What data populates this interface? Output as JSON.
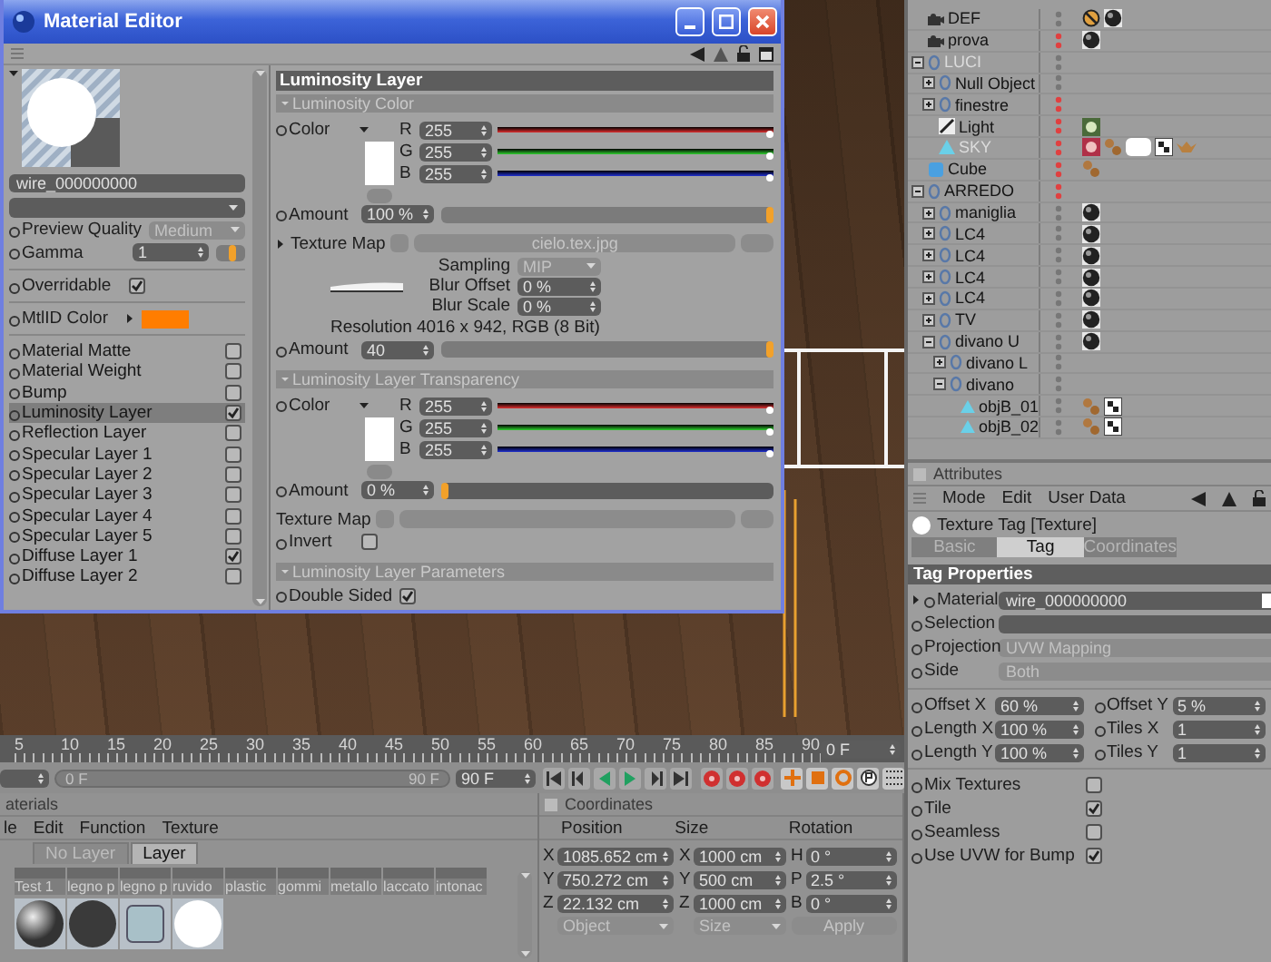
{
  "material_editor": {
    "title": "Material Editor",
    "preview": {
      "name": "wire_000000000"
    },
    "preview_quality": {
      "label": "Preview Quality",
      "value": "Medium"
    },
    "gamma": {
      "label": "Gamma",
      "value": "1",
      "level": 0.55
    },
    "overridable": {
      "label": "Overridable",
      "checked": true
    },
    "mtlid_color": {
      "label": "MtlID Color"
    },
    "channels": [
      {
        "label": "Material Matte",
        "checked": false,
        "selected": false
      },
      {
        "label": "Material Weight",
        "checked": false,
        "selected": false
      },
      {
        "label": "Bump",
        "checked": false,
        "selected": false
      },
      {
        "label": "Luminosity Layer",
        "checked": true,
        "selected": true
      },
      {
        "label": "Reflection Layer",
        "checked": false,
        "selected": false
      },
      {
        "label": "Specular Layer 1",
        "checked": false,
        "selected": false
      },
      {
        "label": "Specular Layer 2",
        "checked": false,
        "selected": false
      },
      {
        "label": "Specular Layer 3",
        "checked": false,
        "selected": false
      },
      {
        "label": "Specular Layer 4",
        "checked": false,
        "selected": false
      },
      {
        "label": "Specular Layer 5",
        "checked": false,
        "selected": false
      },
      {
        "label": "Diffuse Layer 1",
        "checked": true,
        "selected": false
      },
      {
        "label": "Diffuse Layer 2",
        "checked": false,
        "selected": false
      }
    ],
    "layer": {
      "title": "Luminosity Layer",
      "color_section": {
        "title": "Luminosity Color",
        "color": {
          "label": "Color",
          "channels": [
            {
              "name": "R",
              "value": "255",
              "level": 1
            },
            {
              "name": "G",
              "value": "255",
              "level": 1
            },
            {
              "name": "B",
              "value": "255",
              "level": 1
            }
          ]
        },
        "amount": {
          "label": "Amount",
          "value": "100 %",
          "level": 1
        },
        "texture": {
          "label": "Texture Map",
          "file": "cielo.tex.jpg",
          "sampling": {
            "label": "Sampling",
            "value": "MIP"
          },
          "blur_offset": {
            "label": "Blur Offset",
            "value": "0 %"
          },
          "blur_scale": {
            "label": "Blur Scale",
            "value": "0 %"
          },
          "resolution": "Resolution 4016 x 942, RGB (8 Bit)"
        },
        "amount_2": {
          "label": "Amount",
          "value": "40",
          "level": 1
        }
      },
      "transparency_section": {
        "title": "Luminosity Layer Transparency",
        "color": {
          "label": "Color",
          "channels": [
            {
              "name": "R",
              "value": "255",
              "level": 1
            },
            {
              "name": "G",
              "value": "255",
              "level": 1
            },
            {
              "name": "B",
              "value": "255",
              "level": 1
            }
          ]
        },
        "amount": {
          "label": "Amount",
          "value": "0 %",
          "level": 0
        },
        "texture": {
          "label": "Texture Map"
        },
        "invert": {
          "label": "Invert",
          "checked": false
        }
      },
      "parameters_section": {
        "title": "Luminosity Layer Parameters",
        "double_sided": {
          "label": "Double Sided",
          "checked": true
        }
      }
    }
  },
  "timeline": {
    "ruler_labels": [
      "5",
      "10",
      "15",
      "20",
      "25",
      "30",
      "35",
      "40",
      "45",
      "50",
      "55",
      "60",
      "65",
      "70",
      "75",
      "80",
      "85",
      "90"
    ],
    "current_frame": "0 F",
    "range_start": "0 F",
    "range_end": "90 F",
    "end_frame": "90 F"
  },
  "materials": {
    "title": "aterials",
    "menu": [
      "le",
      "Edit",
      "Function",
      "Texture"
    ],
    "tabs": [
      {
        "label": "No Layer",
        "selected": false
      },
      {
        "label": "Layer",
        "selected": true
      }
    ],
    "items": [
      {
        "name": "Test 1"
      },
      {
        "name": "legno p"
      },
      {
        "name": "legno p"
      },
      {
        "name": "ruvido"
      },
      {
        "name": "plastic"
      },
      {
        "name": "gommi"
      },
      {
        "name": "metallo"
      },
      {
        "name": "laccato"
      },
      {
        "name": "intonac"
      }
    ],
    "swatches": [
      {
        "kind": "gradient"
      },
      {
        "kind": "dark"
      },
      {
        "kind": "glass"
      },
      {
        "kind": "white"
      }
    ]
  },
  "coordinates": {
    "title": "Coordinates",
    "columns": [
      "Position",
      "Size",
      "Rotation"
    ],
    "rows": [
      {
        "axes": [
          "X",
          "X",
          "H"
        ],
        "values": [
          "1085.652 cm",
          "1000 cm",
          "0 °"
        ]
      },
      {
        "axes": [
          "Y",
          "Y",
          "P"
        ],
        "values": [
          "750.272 cm",
          "500 cm",
          "2.5 °"
        ]
      },
      {
        "axes": [
          "Z",
          "Z",
          "B"
        ],
        "values": [
          "22.132 cm",
          "1000 cm",
          "0 °"
        ]
      }
    ],
    "modes": [
      "Object",
      "Size"
    ],
    "apply": "Apply"
  },
  "object_manager": {
    "items": [
      {
        "name": "DEF",
        "kind": "camera",
        "visible": true,
        "dimmed": false,
        "tags": [
          {
            "kind": "forbid"
          },
          {
            "kind": "sphere"
          }
        ]
      },
      {
        "name": "prova",
        "kind": "camera",
        "visible": false,
        "dimmed": false,
        "tags": [
          {
            "kind": "sphere"
          }
        ]
      },
      {
        "name": "LUCI",
        "kind": "null",
        "expanded": true,
        "visible": true,
        "dimmed": true,
        "children": [
          {
            "name": "Null Object",
            "kind": "null",
            "expanded": false,
            "visible": true,
            "dimmed": false
          },
          {
            "name": "finestre",
            "kind": "null",
            "expanded": false,
            "visible": false,
            "dimmed": false
          },
          {
            "name": "Light",
            "kind": "light",
            "visible": false,
            "dimmed": false,
            "tags": [
              {
                "kind": "target"
              }
            ]
          },
          {
            "name": "SKY",
            "kind": "triangle",
            "visible": false,
            "dimmed": true,
            "tags": [
              {
                "kind": "badge"
              },
              {
                "kind": "beads"
              },
              {
                "kind": "swatch"
              },
              {
                "kind": "checker"
              },
              {
                "kind": "crown"
              }
            ]
          }
        ]
      },
      {
        "name": "Cube",
        "kind": "cube",
        "visible": false,
        "dimmed": false,
        "tags": [
          {
            "kind": "beads"
          }
        ]
      },
      {
        "name": "ARREDO",
        "kind": "null",
        "expanded": true,
        "visible": false,
        "dimmed": false,
        "children": [
          {
            "name": "maniglia",
            "kind": "null",
            "expanded": false,
            "visible": true,
            "dimmed": false,
            "tags": [
              {
                "kind": "sphere"
              }
            ]
          },
          {
            "name": "LC4",
            "kind": "null",
            "expanded": false,
            "visible": true,
            "dimmed": false,
            "tags": [
              {
                "kind": "sphere"
              }
            ]
          },
          {
            "name": "LC4",
            "kind": "null",
            "expanded": false,
            "visible": true,
            "dimmed": false,
            "tags": [
              {
                "kind": "sphere"
              }
            ]
          },
          {
            "name": "LC4",
            "kind": "null",
            "expanded": false,
            "visible": true,
            "dimmed": false,
            "tags": [
              {
                "kind": "sphere"
              }
            ]
          },
          {
            "name": "LC4",
            "kind": "null",
            "expanded": false,
            "visible": true,
            "dimmed": false,
            "tags": [
              {
                "kind": "sphere"
              }
            ]
          },
          {
            "name": "TV",
            "kind": "null",
            "expanded": false,
            "visible": true,
            "dimmed": false,
            "tags": [
              {
                "kind": "sphere"
              }
            ]
          },
          {
            "name": "divano U",
            "kind": "null",
            "expanded": true,
            "visible": true,
            "dimmed": false,
            "tags": [
              {
                "kind": "sphere"
              }
            ],
            "children": [
              {
                "name": "divano L",
                "kind": "null",
                "expanded": false,
                "visible": true,
                "dimmed": false
              },
              {
                "name": "divano",
                "kind": "null",
                "expanded": true,
                "visible": true,
                "dimmed": false,
                "children": [
                  {
                    "name": "objB_01",
                    "kind": "triangle",
                    "visible": true,
                    "dimmed": false,
                    "tags": [
                      {
                        "kind": "beads"
                      },
                      {
                        "kind": "checker"
                      }
                    ]
                  },
                  {
                    "name": "objB_02",
                    "kind": "triangle",
                    "visible": true,
                    "dimmed": false,
                    "tags": [
                      {
                        "kind": "beads"
                      },
                      {
                        "kind": "checker"
                      }
                    ]
                  }
                ]
              }
            ]
          }
        ]
      }
    ]
  },
  "attributes": {
    "title": "Attributes",
    "menu": [
      "Mode",
      "Edit",
      "User Data"
    ],
    "object": "Texture Tag [Texture]",
    "tabs": [
      {
        "label": "Basic",
        "selected": false
      },
      {
        "label": "Tag",
        "selected": true
      },
      {
        "label": "Coordinates",
        "selected": false
      }
    ],
    "section": "Tag Properties",
    "fields": [
      {
        "label": "Material",
        "value": "wire_000000000"
      },
      {
        "label": "Selection"
      },
      {
        "label": "Projection",
        "value": "UVW Mapping"
      },
      {
        "label": "Side",
        "value": "Both"
      }
    ],
    "pairs": [
      [
        {
          "label": "Offset X",
          "value": "60 %"
        },
        {
          "label": "Offset Y",
          "value": "5 %"
        }
      ],
      [
        {
          "label": "Length X",
          "value": "100 %"
        },
        {
          "label": "Tiles X",
          "value": "1"
        }
      ],
      [
        {
          "label": "Length Y",
          "value": "100 %"
        },
        {
          "label": "Tiles Y",
          "value": "1"
        }
      ]
    ],
    "checks": [
      {
        "label": "Mix Textures",
        "checked": false
      },
      {
        "label": "Tile",
        "checked": true
      },
      {
        "label": "Seamless",
        "checked": false
      },
      {
        "label": "Use UVW for Bump",
        "checked": true
      }
    ]
  }
}
